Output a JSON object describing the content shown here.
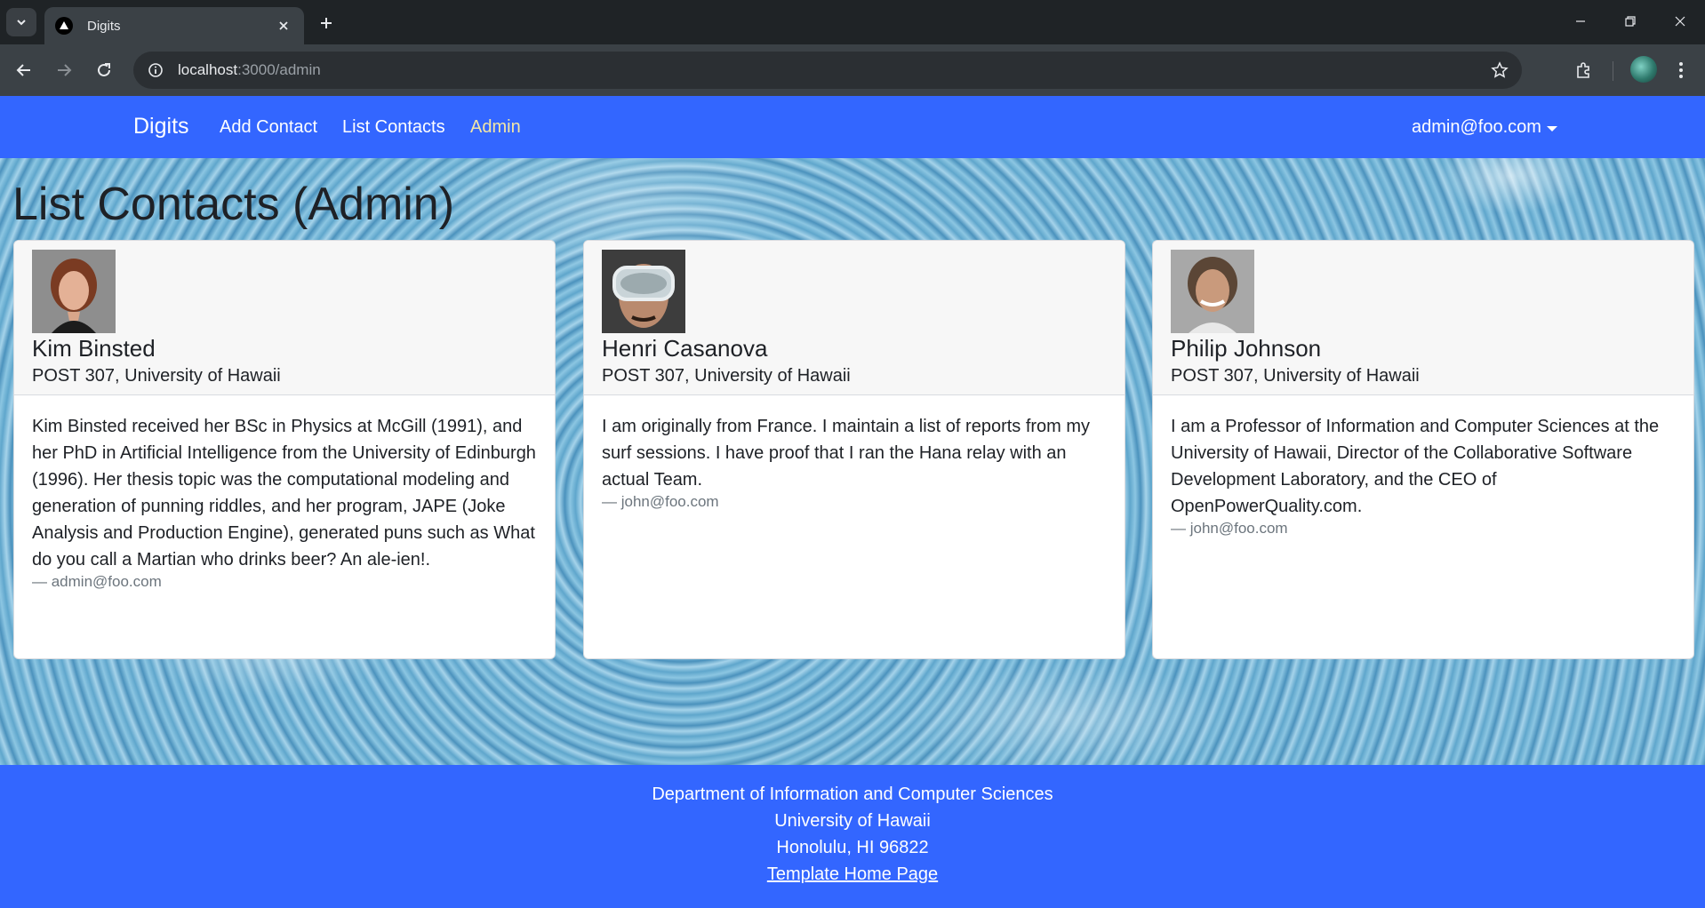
{
  "browser": {
    "tab_title": "Digits",
    "url_host": "localhost",
    "url_path": ":3000/admin"
  },
  "navbar": {
    "brand": "Digits",
    "links": [
      "Add Contact",
      "List Contacts",
      "Admin"
    ],
    "active_link": "Admin",
    "user": "admin@foo.com"
  },
  "page": {
    "title": "List Contacts (Admin)"
  },
  "contacts": [
    {
      "name": "Kim Binsted",
      "address": "POST 307, University of Hawaii",
      "description": "Kim Binsted received her BSc in Physics at McGill (1991), and her PhD in Artificial Intelligence from the University of Edinburgh (1996). Her thesis topic was the computational modeling and generation of punning riddles, and her program, JAPE (Joke Analysis and Production Engine), generated puns such as What do you call a Martian who drinks beer? An ale-ien!.",
      "owner": "— admin@foo.com"
    },
    {
      "name": "Henri Casanova",
      "address": "POST 307, University of Hawaii",
      "description": "I am originally from France. I maintain a list of reports from my surf sessions. I have proof that I ran the Hana relay with an actual Team.",
      "owner": "— john@foo.com"
    },
    {
      "name": "Philip Johnson",
      "address": "POST 307, University of Hawaii",
      "description": "I am a Professor of Information and Computer Sciences at the University of Hawaii, Director of the Collaborative Software Development Laboratory, and the CEO of OpenPowerQuality.com.",
      "owner": "— john@foo.com"
    }
  ],
  "footer": {
    "line1": "Department of Information and Computer Sciences",
    "line2": "University of Hawaii",
    "line3": "Honolulu, HI 96822",
    "link": "Template Home Page"
  },
  "colors": {
    "navbar": "#3366ff",
    "active_link": "#f3e6a6"
  }
}
